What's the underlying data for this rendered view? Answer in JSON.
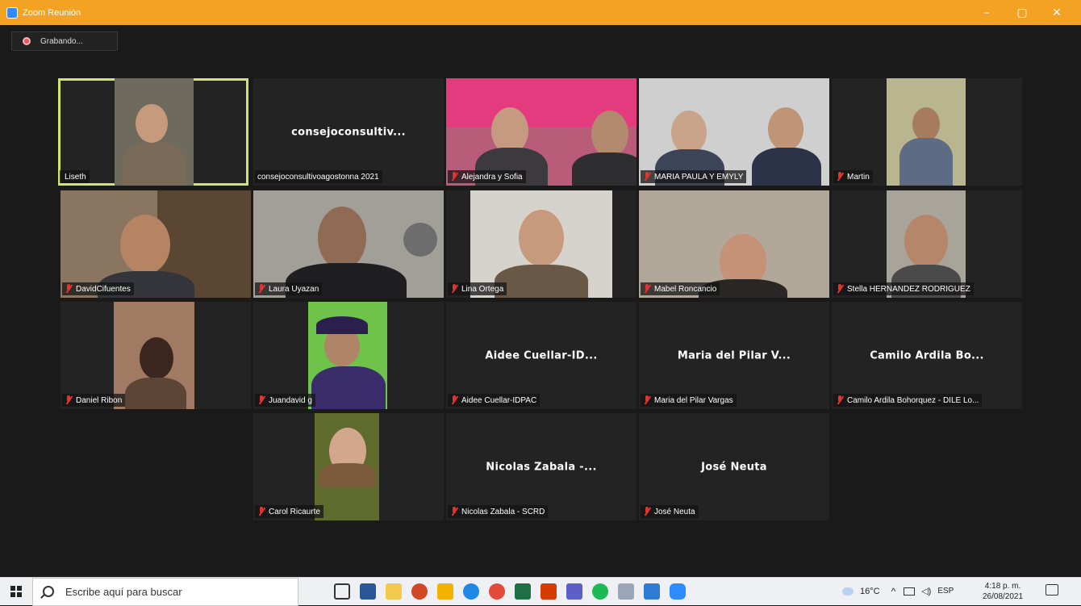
{
  "window": {
    "title": "Zoom Reunión",
    "minimize_glyph": "–",
    "maximize_glyph": "▢",
    "close_glyph": "✕"
  },
  "recording": {
    "label": "Grabando..."
  },
  "participants": [
    {
      "name": "Liseth",
      "big_name": "",
      "has_video": true
    },
    {
      "name": "consejoconsultivoagostonna 2021",
      "big_name": "consejoconsultiv...",
      "has_video": false
    },
    {
      "name": "Alejandra y Sofia",
      "big_name": "",
      "has_video": true
    },
    {
      "name": "MARIA PAULA Y EMYLY",
      "big_name": "",
      "has_video": true
    },
    {
      "name": "Martin",
      "big_name": "",
      "has_video": true
    },
    {
      "name": "DavidCifuentes",
      "big_name": "",
      "has_video": true
    },
    {
      "name": "Laura Uyazan",
      "big_name": "",
      "has_video": true
    },
    {
      "name": "Lina Ortega",
      "big_name": "",
      "has_video": true
    },
    {
      "name": "Mabel Roncancio",
      "big_name": "",
      "has_video": true
    },
    {
      "name": "Stella HERNANDEZ RODRIGUEZ",
      "big_name": "",
      "has_video": true
    },
    {
      "name": "Daniel Ribon",
      "big_name": "",
      "has_video": true
    },
    {
      "name": "Juandavid g",
      "big_name": "",
      "has_video": true
    },
    {
      "name": "Aidee Cuellar-IDPAC",
      "big_name": "Aidee Cuellar-ID...",
      "has_video": false
    },
    {
      "name": "Maria del Pilar Vargas",
      "big_name": "Maria del Pilar V...",
      "has_video": false
    },
    {
      "name": "Camilo Ardila Bohorquez - DILE Lo...",
      "big_name": "Camilo Ardila Bo...",
      "has_video": false
    },
    {
      "name": "Carol Ricaurte",
      "big_name": "",
      "has_video": true
    },
    {
      "name": "Nicolas Zabala - SCRD",
      "big_name": "Nicolas Zabala -...",
      "has_video": false
    },
    {
      "name": "José Neuta",
      "big_name": "José Neuta",
      "has_video": false
    }
  ],
  "taskbar": {
    "search_placeholder": "Escribe aquí para buscar",
    "weather": "16°C",
    "language": "ESP",
    "time": "4:18 p. m.",
    "date": "26/08/2021"
  },
  "colors": {
    "titlebar": "#f4a224",
    "active_speaker": "#d6e36a",
    "muted_mic": "#e0342e"
  }
}
